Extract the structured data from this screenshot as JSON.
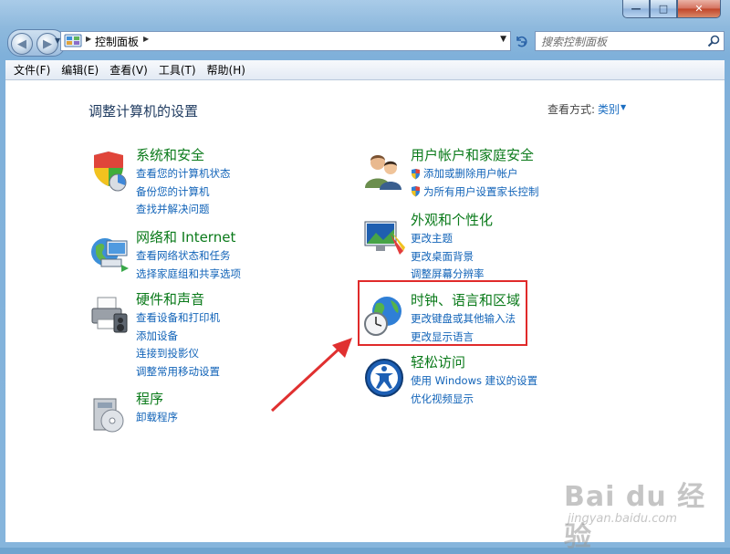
{
  "window": {
    "caption_buttons": {
      "minimize": "—",
      "maximize": "□",
      "close": "✕"
    }
  },
  "address_bar": {
    "crumbs": [
      "控制面板"
    ],
    "refresh_icon": "refresh-icon"
  },
  "search": {
    "placeholder": "搜索控制面板"
  },
  "menubar": {
    "items": [
      "文件(F)",
      "编辑(E)",
      "查看(V)",
      "工具(T)",
      "帮助(H)"
    ]
  },
  "content": {
    "title": "调整计算机的设置",
    "view_by_label": "查看方式:",
    "view_by_value": "类别"
  },
  "categories": [
    {
      "title": "系统和安全",
      "icon": "shield-icon",
      "links": [
        "查看您的计算机状态",
        "备份您的计算机",
        "查找并解决问题"
      ]
    },
    {
      "title": "网络和 Internet",
      "icon": "network-icon",
      "links": [
        "查看网络状态和任务",
        "选择家庭组和共享选项"
      ]
    },
    {
      "title": "硬件和声音",
      "icon": "printer-icon",
      "links": [
        "查看设备和打印机",
        "添加设备",
        "连接到投影仪",
        "调整常用移动设置"
      ]
    },
    {
      "title": "程序",
      "icon": "programs-icon",
      "links": [
        "卸载程序"
      ]
    },
    {
      "title": "用户帐户和家庭安全",
      "icon": "users-icon",
      "links": [
        "添加或删除用户帐户",
        "为所有用户设置家长控制"
      ]
    },
    {
      "title": "外观和个性化",
      "icon": "appearance-icon",
      "links": [
        "更改主题",
        "更改桌面背景",
        "调整屏幕分辨率"
      ]
    },
    {
      "title": "时钟、语言和区域",
      "icon": "globe-clock-icon",
      "links": [
        "更改键盘或其他输入法",
        "更改显示语言"
      ]
    },
    {
      "title": "轻松访问",
      "icon": "ease-of-access-icon",
      "links": [
        "使用 Windows 建议的设置",
        "优化视频显示"
      ]
    }
  ],
  "annotation": {
    "highlight_color": "#e02a2a"
  },
  "watermark": {
    "main": "Bai du 经验",
    "sub": "jingyan.baidu.com"
  }
}
